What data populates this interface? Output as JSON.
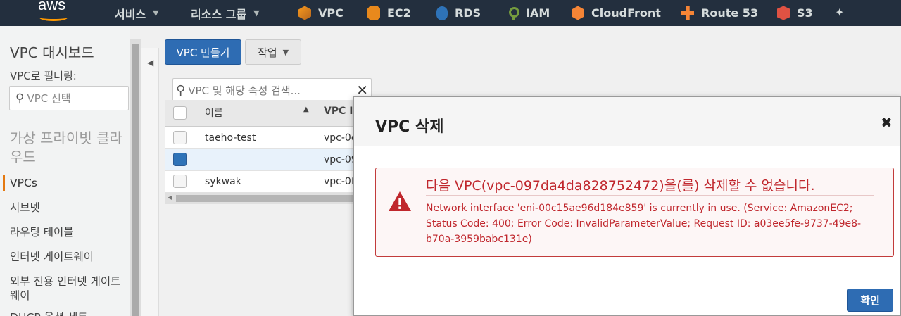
{
  "topnav": {
    "logo": "aws",
    "services_label": "서비스",
    "resource_groups_label": "리소스 그룹",
    "links": [
      {
        "label": "VPC",
        "icon": "vpc-icon"
      },
      {
        "label": "EC2",
        "icon": "ec2-icon"
      },
      {
        "label": "RDS",
        "icon": "rds-icon"
      },
      {
        "label": "IAM",
        "icon": "iam-icon"
      },
      {
        "label": "CloudFront",
        "icon": "cloudfront-icon"
      },
      {
        "label": "Route 53",
        "icon": "route53-icon"
      },
      {
        "label": "S3",
        "icon": "s3-icon"
      }
    ],
    "pin_icon": "pin-icon"
  },
  "sidebar": {
    "title": "VPC 대시보드",
    "filter_label": "VPC로 필터링:",
    "filter_placeholder": "VPC 선택",
    "section_title": "가상 프라이빗 클라우드",
    "items": [
      {
        "label": "VPCs"
      },
      {
        "label": "서브넷"
      },
      {
        "label": "라우팅 테이블"
      },
      {
        "label": "인터넷 게이트웨이"
      },
      {
        "label": "외부 전용 인터넷 게이트웨이"
      },
      {
        "label": "DHCP 옵션 세트"
      }
    ]
  },
  "toolbar": {
    "create_label": "VPC 만들기",
    "action_label": "작업"
  },
  "search": {
    "placeholder": "VPC 및 해당 속성 검색..."
  },
  "table": {
    "columns": [
      "이름",
      "VPC ID"
    ],
    "rows": [
      {
        "name": "taeho-test",
        "vpc_id": "vpc-0e",
        "selected": false
      },
      {
        "name": "",
        "vpc_id": "vpc-09",
        "selected": true
      },
      {
        "name": "sykwak",
        "vpc_id": "vpc-0f",
        "selected": false
      }
    ]
  },
  "modal": {
    "title": "VPC 삭제",
    "close_label": "✖",
    "error_title": "다음 VPC(vpc-097da4da828752472)을(를) 삭제할 수 없습니다.",
    "error_message": "Network interface 'eni-00c15ae96d184e859' is currently in use. (Service: AmazonEC2; Status Code: 400; Error Code: InvalidParameterValue; Request ID: a03ee5fe-9737-49e8-b70a-3959babc131e)",
    "confirm_label": "확인"
  },
  "colors": {
    "nav_bg": "#232f3e",
    "primary": "#2e6cb3",
    "error": "#c0272d",
    "active_accent": "#e47911"
  }
}
